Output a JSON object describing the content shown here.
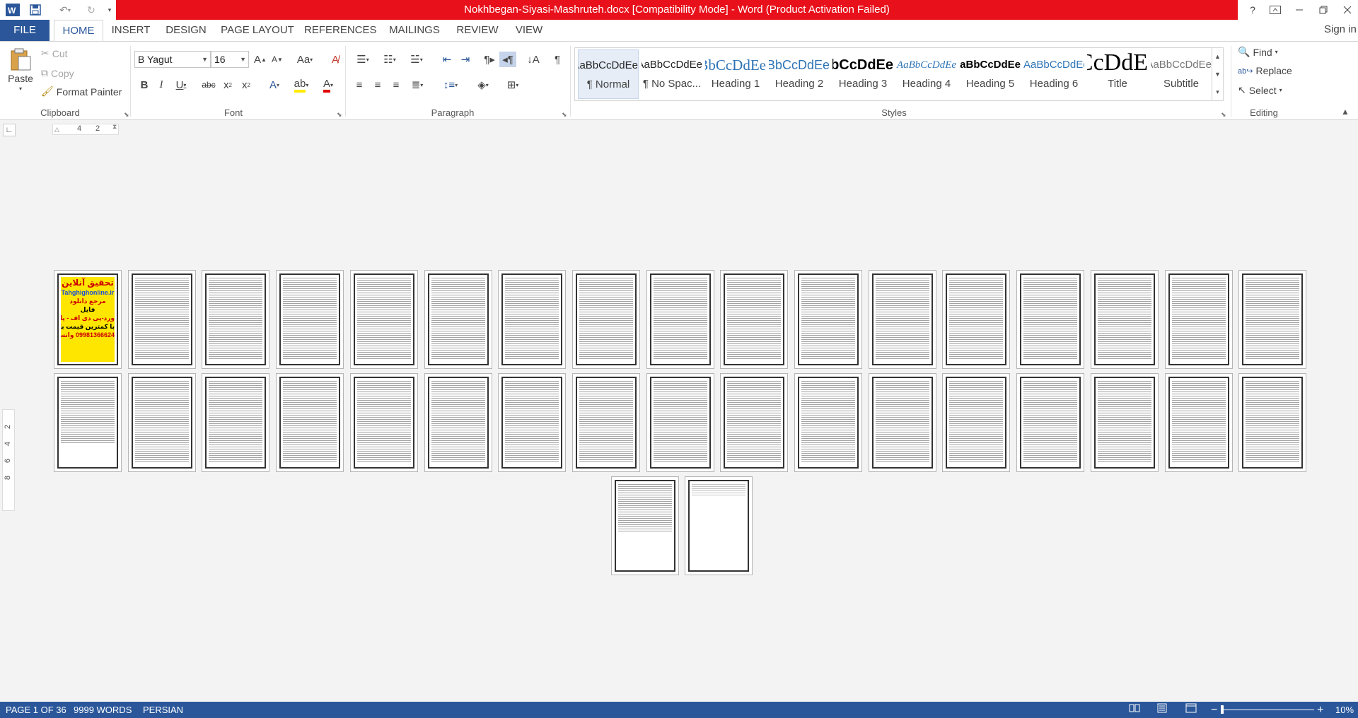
{
  "window": {
    "title": "Nokhbegan-Siyasi-Mashruteh.docx [Compatibility Mode] -  Word (Product Activation Failed)",
    "title_bar_color": "#e8101a",
    "accent": "#2b579a"
  },
  "quick_access": {
    "icons": [
      "word-icon",
      "save-icon",
      "undo-icon",
      "redo-icon",
      "customize-icon"
    ]
  },
  "window_controls": {
    "help": "?"
  },
  "tabs": [
    {
      "label": "FILE"
    },
    {
      "label": "HOME"
    },
    {
      "label": "INSERT"
    },
    {
      "label": "DESIGN"
    },
    {
      "label": "PAGE LAYOUT"
    },
    {
      "label": "REFERENCES"
    },
    {
      "label": "MAILINGS"
    },
    {
      "label": "REVIEW"
    },
    {
      "label": "VIEW"
    }
  ],
  "sign_in": "Sign in",
  "clipboard": {
    "paste": "Paste",
    "cut": "Cut",
    "copy": "Copy",
    "format_painter": "Format Painter",
    "group_label": "Clipboard"
  },
  "font": {
    "name": "B Yagut",
    "size": "16",
    "group_label": "Font"
  },
  "paragraph": {
    "group_label": "Paragraph"
  },
  "styles": {
    "group_label": "Styles",
    "items": [
      {
        "sample": "AaBbCcDdEe",
        "name": "¶ Normal",
        "selected": true
      },
      {
        "sample": "AaBbCcDdEe",
        "name": "¶ No Spac..."
      },
      {
        "sample": "AaBbCcDdEe",
        "name": "Heading 1"
      },
      {
        "sample": "AaBbCcDdEe",
        "name": "Heading 2"
      },
      {
        "sample": "AaBbCcDdEe",
        "name": "Heading 3"
      },
      {
        "sample": "AaBbCcDdEe",
        "name": "Heading 4"
      },
      {
        "sample": "AaBbCcDdEe",
        "name": "Heading 5"
      },
      {
        "sample": "AaBbCcDdEe",
        "name": "Heading 6"
      },
      {
        "sample": "AaBbCcDdE",
        "name": "Title"
      },
      {
        "sample": "AaBbCcDdEe",
        "name": "Subtitle"
      }
    ]
  },
  "editing": {
    "find": "Find",
    "replace": "Replace",
    "select": "Select",
    "group_label": "Editing"
  },
  "ruler": {
    "marks": [
      "4",
      "2"
    ]
  },
  "vertical_ruler": {
    "marks": [
      "2",
      "4",
      "6",
      "8"
    ]
  },
  "document": {
    "page_count": 36,
    "cover": {
      "lines": [
        "تحقیق آنلاین",
        "Tahghighonline.ir",
        "مرجع دانلود",
        "فایل",
        "ورد-پی دی اف - پاورپوینت",
        "با کمترین قیمت بازار",
        "09981366624 واتساپ"
      ]
    }
  },
  "status": {
    "page": "PAGE 1 OF 36",
    "words": "9999 WORDS",
    "language": "PERSIAN",
    "zoom": "10%"
  }
}
